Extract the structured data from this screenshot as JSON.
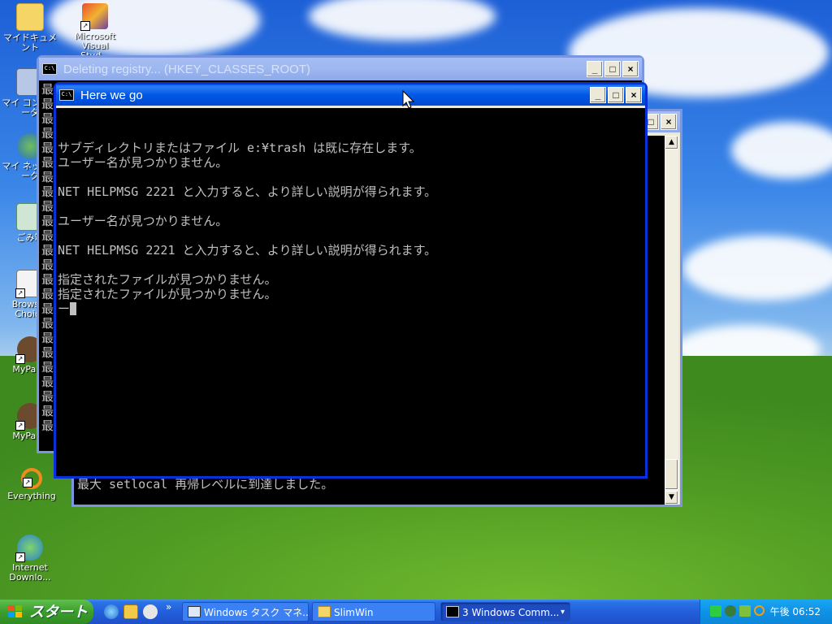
{
  "desktop": {
    "icons": [
      {
        "label": "マイドキュメント"
      },
      {
        "label": "Microsoft Visual Stud..."
      },
      {
        "label": "マイ コンピュータ"
      },
      {
        "label": "マイ ネットワーク"
      },
      {
        "label": "ごみ箱"
      },
      {
        "label": "Browser Choice"
      },
      {
        "label": "MyPaint"
      },
      {
        "label": "MyPaint"
      },
      {
        "label": "Everything"
      },
      {
        "label": "Internet Downlo..."
      }
    ]
  },
  "windows": {
    "registry": {
      "title": "Deleting registry... (HKEY_CLASSES_ROOT)",
      "side_glyph": "最"
    },
    "back": {
      "status_line": "最大 setlocal 再帰レベルに到達しました。"
    },
    "main": {
      "title": "Here we go",
      "lines": [
        "サブディレクトリまたはファイル e:¥trash は既に存在します。",
        "ユーザー名が見つかりません。",
        "",
        "NET HELPMSG 2221 と入力すると、より詳しい説明が得られます。",
        "",
        "ユーザー名が見つかりません。",
        "",
        "NET HELPMSG 2221 と入力すると、より詳しい説明が得られます。",
        "",
        "指定されたファイルが見つかりません。",
        "指定されたファイルが見つかりません。",
        "ー"
      ]
    },
    "buttons": {
      "minimize": "_",
      "maximize": "□",
      "close": "×"
    },
    "sys_icon": "C:\\"
  },
  "taskbar": {
    "start_label": "スタート",
    "overflow": "»",
    "tasks": [
      {
        "label": "Windows タスク マネ..."
      },
      {
        "label": "SlimWin"
      },
      {
        "label": "3 Windows Comm..."
      }
    ],
    "group_arrow": "▾",
    "clock": "午後 06:52"
  },
  "colors": {
    "title_active": "#0058e6",
    "title_inactive": "#8ea9ea",
    "console_bg": "#000000",
    "console_fg": "#c0c0c0",
    "start_green": "#3c9e2c",
    "taskbar_blue": "#245edb"
  }
}
